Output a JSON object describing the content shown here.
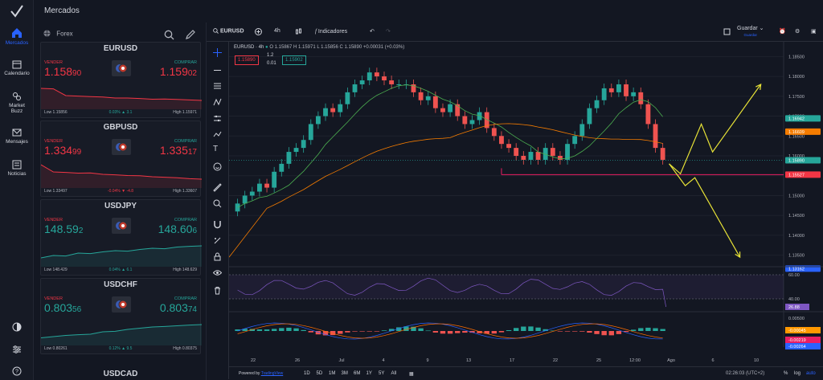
{
  "app": {
    "title": "Mercados",
    "market_category": "Forex"
  },
  "nav": [
    {
      "label": "Mercados",
      "icon": "home-icon",
      "active": true
    },
    {
      "label": "Calendario",
      "icon": "calendar-icon"
    },
    {
      "label": "Market Buzz",
      "icon": "buzz-icon"
    },
    {
      "label": "Mensajes",
      "icon": "mail-icon"
    },
    {
      "label": "Noticias",
      "icon": "news-icon"
    }
  ],
  "quotes": [
    {
      "symbol": "EURUSD",
      "sell_label": "VENDER",
      "buy_label": "COMPRAR",
      "sell_main": "1.158",
      "sell_tail": "90",
      "buy_main": "1.159",
      "buy_tail": "02",
      "low": "Low 1.15856",
      "change": "0.03% ▲ 3.1",
      "high": "High 1.15971",
      "trend": "down",
      "spark": [
        0.3,
        0.32,
        0.6,
        0.62,
        0.64,
        0.66,
        0.7,
        0.7,
        0.72,
        0.75,
        0.74,
        0.76,
        0.78,
        0.8
      ]
    },
    {
      "symbol": "GBPUSD",
      "sell_label": "VENDER",
      "buy_label": "COMPRAR",
      "sell_main": "1.334",
      "sell_tail": "99",
      "buy_main": "1.335",
      "buy_tail": "17",
      "low": "Low 1.33497",
      "change": "-0.04% ▼ -4.8",
      "high": "High 1.33607",
      "trend": "down",
      "spark": [
        0.2,
        0.5,
        0.52,
        0.55,
        0.54,
        0.6,
        0.62,
        0.65,
        0.66,
        0.7,
        0.72,
        0.74,
        0.78,
        0.8
      ]
    },
    {
      "symbol": "USDJPY",
      "sell_label": "VENDER",
      "buy_label": "COMPRAR",
      "sell_main": "148.59",
      "sell_tail": "2",
      "buy_main": "148.60",
      "buy_tail": "6",
      "low": "Low 148.429",
      "change": "0.04% ▲ 6.1",
      "high": "High 148.629",
      "trend": "up",
      "spark": [
        0.8,
        0.7,
        0.72,
        0.6,
        0.62,
        0.55,
        0.5,
        0.52,
        0.45,
        0.4,
        0.42,
        0.35,
        0.32,
        0.3
      ]
    },
    {
      "symbol": "USDCHF",
      "sell_label": "VENDER",
      "buy_label": "COMPRAR",
      "sell_main": "0.803",
      "sell_tail": "56",
      "buy_main": "0.803",
      "buy_tail": "74",
      "low": "Low 0.80261",
      "change": "0.12% ▲ 9.5",
      "high": "High 0.80375",
      "trend": "up",
      "spark": [
        0.85,
        0.8,
        0.75,
        0.72,
        0.7,
        0.6,
        0.58,
        0.5,
        0.45,
        0.4,
        0.38,
        0.35,
        0.32,
        0.3
      ]
    }
  ],
  "next_symbol": "USDCAD",
  "toolbar": {
    "symbol": "EURUSD",
    "interval": "4h",
    "indicators": "Indicadores",
    "save": "Guardar",
    "save_sub": "Guardar"
  },
  "legend": {
    "title": "EURUSD · 4h",
    "ohlc": "O 1.15867  H 1.15971  L 1.15856  C 1.15890  +0.00031 (+0.03%)",
    "sell": "1.15890",
    "spread": "1.2",
    "lot": "0.01",
    "buy": "1.15902"
  },
  "chart_data": {
    "type": "candlestick",
    "y_axis": [
      "1.18500",
      "1.18000",
      "1.17500",
      "1.17000",
      "1.16500",
      "1.16000",
      "1.15500",
      "1.15000",
      "1.14500",
      "1.14000",
      "1.13500"
    ],
    "y_range": [
      1.1325,
      1.1875
    ],
    "price_badges": [
      {
        "value": "1.16942",
        "color": "#26a69a",
        "y": 1.16942
      },
      {
        "value": "1.16609",
        "color": "#f57c00",
        "y": 1.16609
      },
      {
        "value": "1.15890",
        "color": "#26a69a",
        "y": 1.1589
      },
      {
        "value": "1.15527",
        "color": "#f23645",
        "y": 1.15527
      },
      {
        "value": "1.13162",
        "color": "#2962ff",
        "y": 1.13162
      }
    ],
    "x_axis": [
      "22",
      "26",
      "Jul",
      "4",
      "9",
      "13",
      "17",
      "22",
      "25",
      "12:00",
      "Ago",
      "6",
      "10"
    ],
    "candles_close": [
      1.148,
      1.15,
      1.151,
      1.153,
      1.152,
      1.156,
      1.158,
      1.161,
      1.162,
      1.164,
      1.168,
      1.17,
      1.172,
      1.171,
      1.173,
      1.176,
      1.178,
      1.179,
      1.181,
      1.18,
      1.179,
      1.178,
      1.178,
      1.178,
      1.176,
      1.174,
      1.175,
      1.172,
      1.171,
      1.173,
      1.17,
      1.168,
      1.169,
      1.171,
      1.167,
      1.165,
      1.163,
      1.162,
      1.16,
      1.159,
      1.161,
      1.159,
      1.162,
      1.16,
      1.159,
      1.163,
      1.165,
      1.168,
      1.172,
      1.174,
      1.177,
      1.176,
      1.178,
      1.175,
      1.176,
      1.173,
      1.168,
      1.162,
      1.159
    ],
    "resistance_level": 1.15527,
    "rsi": {
      "levels": [
        "60.00",
        "40.00"
      ],
      "current": "26.88"
    },
    "macd": {
      "labels": [
        "0.00500",
        "-0.00045",
        "-0.00219",
        "-0.00264"
      ]
    }
  },
  "bottom": {
    "powered": "Powered by",
    "provider": "TradingView",
    "ranges": [
      "1D",
      "5D",
      "1M",
      "3M",
      "6M",
      "1Y",
      "5Y",
      "All"
    ],
    "time": "02:26:03 (UTC+2)",
    "pct": "%",
    "log": "log",
    "auto": "auto"
  }
}
